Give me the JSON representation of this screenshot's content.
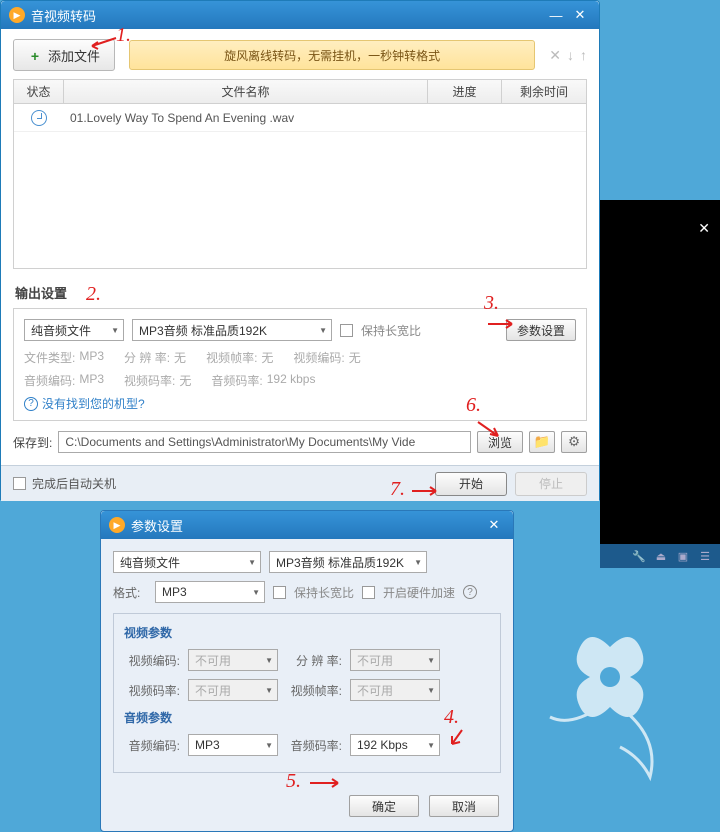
{
  "window": {
    "title": "音视频转码",
    "add_button": "添加文件",
    "banner": "旋风离线转码，无需挂机，一秒钟转格式",
    "table": {
      "headers": {
        "status": "状态",
        "name": "文件名称",
        "progress": "进度",
        "time": "剩余时间"
      },
      "rows": [
        {
          "name": "01.Lovely Way To Spend An Evening .wav"
        }
      ]
    },
    "output_section_title": "输出设置",
    "file_type_select": "纯音频文件",
    "format_select": "MP3音频 标准品质192K",
    "keep_aspect_label": "保持长宽比",
    "param_button": "参数设置",
    "info": {
      "file_type_label": "文件类型:",
      "file_type_val": "MP3",
      "resolution_label": "分 辨 率:",
      "resolution_val": "无",
      "vfps_label": "视频帧率:",
      "vfps_val": "无",
      "vcodec_label": "视频编码:",
      "vcodec_val": "无",
      "acodec_label": "音频编码:",
      "acodec_val": "MP3",
      "vbitrate_label": "视频码率:",
      "vbitrate_val": "无",
      "abitrate_label": "音频码率:",
      "abitrate_val": "192 kbps"
    },
    "help_link": "没有找到您的机型?",
    "saveto_label": "保存到:",
    "saveto_path": "C:\\Documents and Settings\\Administrator\\My Documents\\My Vide",
    "browse_button": "浏览",
    "shutdown_label": "完成后自动关机",
    "start_button": "开始",
    "stop_button": "停止"
  },
  "dialog": {
    "title": "参数设置",
    "type_select": "纯音频文件",
    "preset_select": "MP3音频 标准品质192K",
    "format_label": "格式:",
    "format_value": "MP3",
    "keep_aspect": "保持长宽比",
    "hwaccel": "开启硬件加速",
    "video_title": "视频参数",
    "audio_title": "音频参数",
    "vcodec_label": "视频编码:",
    "vcodec_val": "不可用",
    "res_label": "分 辨 率:",
    "res_val": "不可用",
    "vbitrate_label": "视频码率:",
    "vbitrate_val": "不可用",
    "vfps_label": "视频帧率:",
    "vfps_val": "不可用",
    "acodec_label": "音频编码:",
    "acodec_val": "MP3",
    "abitrate_label": "音频码率:",
    "abitrate_val": "192 Kbps",
    "ok_button": "确定",
    "cancel_button": "取消"
  },
  "annotations": {
    "a1": "1.",
    "a2": "2.",
    "a3": "3.",
    "a4": "4.",
    "a5": "5.",
    "a6": "6.",
    "a7": "7."
  }
}
